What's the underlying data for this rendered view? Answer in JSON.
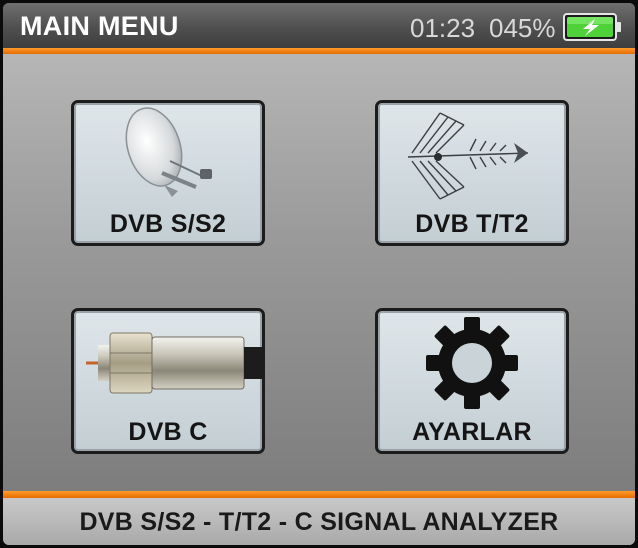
{
  "header": {
    "title": "MAIN MENU",
    "time": "01:23",
    "battery_percent": "045%",
    "battery_icon": "battery-charging-icon"
  },
  "menu": {
    "items": [
      {
        "label": "DVB S/S2",
        "icon": "satellite-dish-icon"
      },
      {
        "label": "DVB T/T2",
        "icon": "antenna-icon"
      },
      {
        "label": "DVB C",
        "icon": "coax-connector-icon"
      },
      {
        "label": "AYARLAR",
        "icon": "gear-icon"
      }
    ]
  },
  "footer": {
    "text": "DVB S/S2 - T/T2 - C SIGNAL ANALYZER"
  },
  "colors": {
    "accent": "#e56c00",
    "header_bg": "#4f4f4f",
    "tile_bg": "#c3ced3",
    "battery_green": "#4fd13a"
  }
}
